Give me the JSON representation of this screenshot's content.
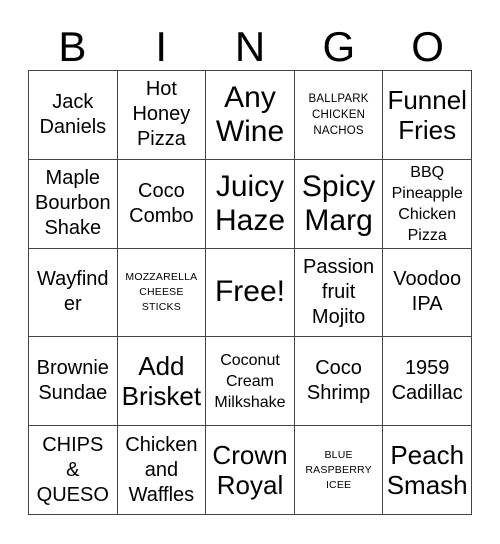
{
  "card": {
    "title_letters": [
      "B",
      "I",
      "N",
      "G",
      "O"
    ],
    "free_space_label": "Free!",
    "colors": {
      "background": "#ffffff",
      "text": "#000000",
      "border": "#444444"
    },
    "grid": {
      "columns": 5,
      "rows": 5,
      "cells": [
        [
          {
            "text": "Jack\nDaniels",
            "size": "md"
          },
          {
            "text": "Hot\nHoney\nPizza",
            "size": "md"
          },
          {
            "text": "Any\nWine",
            "size": "xl"
          },
          {
            "text": "BALLPARK\nCHICKEN\nNACHOS",
            "size": "xs"
          },
          {
            "text": "Funnel\nFries",
            "size": "lg"
          }
        ],
        [
          {
            "text": "Maple\nBourbon\nShake",
            "size": "md"
          },
          {
            "text": "Coco\nCombo",
            "size": "md"
          },
          {
            "text": "Juicy\nHaze",
            "size": "xl"
          },
          {
            "text": "Spicy\nMarg",
            "size": "xl"
          },
          {
            "text": "BBQ\nPineapple\nChicken\nPizza",
            "size": "sm"
          }
        ],
        [
          {
            "text": "Wayfinder",
            "size": "md"
          },
          {
            "text": "MOZZARELLA\nCHEESE\nSTICKS",
            "size": "xxs"
          },
          {
            "text": "Free!",
            "size": "xl"
          },
          {
            "text": "Passion\nfruit\nMojito",
            "size": "md"
          },
          {
            "text": "Voodoo\nIPA",
            "size": "md"
          }
        ],
        [
          {
            "text": "Brownie\nSundae",
            "size": "md"
          },
          {
            "text": "Add\nBrisket",
            "size": "lg"
          },
          {
            "text": "Coconut\nCream\nMilkshake",
            "size": "sm"
          },
          {
            "text": "Coco\nShrimp",
            "size": "md"
          },
          {
            "text": "1959\nCadillac",
            "size": "md"
          }
        ],
        [
          {
            "text": "CHIPS\n&\nQUESO",
            "size": "md"
          },
          {
            "text": "Chicken\nand\nWaffles",
            "size": "md"
          },
          {
            "text": "Crown\nRoyal",
            "size": "lg"
          },
          {
            "text": "BLUE\nRASPBERRY\nICEE",
            "size": "xxs"
          },
          {
            "text": "Peach\nSmash",
            "size": "lg"
          }
        ]
      ]
    }
  }
}
